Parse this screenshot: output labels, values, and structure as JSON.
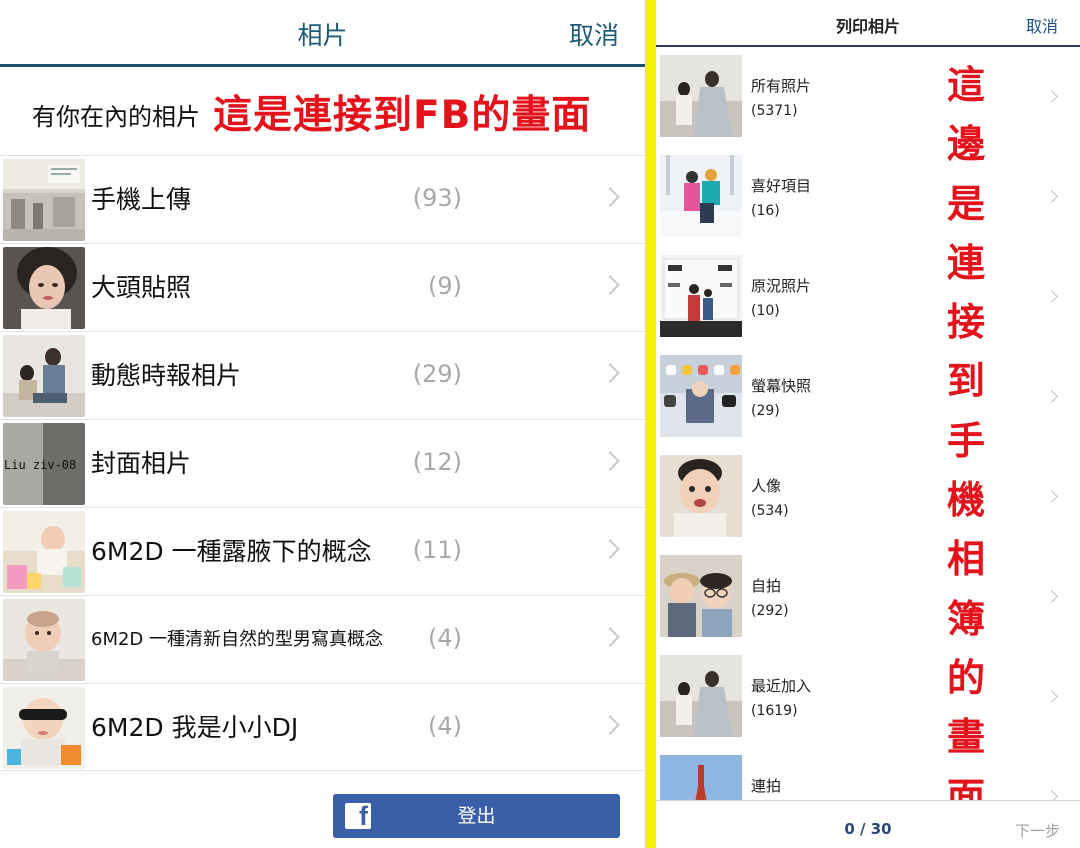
{
  "left": {
    "header": {
      "title": "相片",
      "cancel": "取消"
    },
    "section_title": "有你在內的相片",
    "annotation": "這是連接到FB的畫面",
    "albums": [
      {
        "name": "手機上傳",
        "count": "(93)"
      },
      {
        "name": "大頭貼照",
        "count": "(9)"
      },
      {
        "name": "動態時報相片",
        "count": "(29)"
      },
      {
        "name": "封面相片",
        "count": "(12)"
      },
      {
        "name": "6M2D 一種露腋下的概念",
        "count": "(11)"
      },
      {
        "name": "6M2D 一種清新自然的型男寫真概念",
        "count": "(4)"
      },
      {
        "name": "6M2D 我是小小DJ",
        "count": "(4)"
      }
    ],
    "cover_thumb_text": "Liu ziv-08",
    "logout_label": "登出",
    "fb_logo_letter": "f"
  },
  "right": {
    "header": {
      "title": "列印相片",
      "cancel": "取消"
    },
    "albums": [
      {
        "name": "所有照片",
        "count": "(5371)"
      },
      {
        "name": "喜好項目",
        "count": "(16)"
      },
      {
        "name": "原況照片",
        "count": "(10)"
      },
      {
        "name": "螢幕快照",
        "count": "(29)"
      },
      {
        "name": "人像",
        "count": "(534)"
      },
      {
        "name": "自拍",
        "count": "(292)"
      },
      {
        "name": "最近加入",
        "count": "(1619)"
      },
      {
        "name": "連拍",
        "count": ""
      }
    ],
    "annotation_chars": [
      "這",
      "邊",
      "是",
      "連",
      "接",
      "到",
      "手",
      "機",
      "相",
      "簿",
      "的",
      "畫",
      "面"
    ],
    "footer": {
      "counter": "0 / 30",
      "next": "下一步"
    }
  },
  "colors": {
    "fb_blue": "#3b5ea8",
    "header_teal": "#1d5b78",
    "annotation_red": "#e3121b",
    "divider_yellow": "#f4f200"
  }
}
